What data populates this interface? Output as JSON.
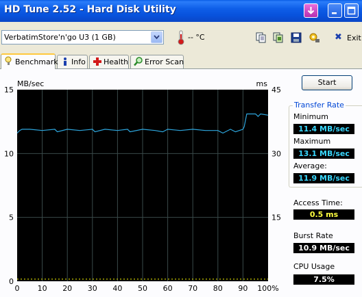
{
  "window": {
    "title": "HD Tune 2.52 - Hard Disk Utility"
  },
  "toolbar": {
    "drive": "VerbatimStore'n'go U3 (1 GB)",
    "temperature": "-- °C",
    "exit_label": "Exit"
  },
  "tabs": [
    {
      "label": "Benchmark"
    },
    {
      "label": "Info"
    },
    {
      "label": "Health"
    },
    {
      "label": "Error Scan"
    }
  ],
  "chart": {
    "y_left_unit": "MB/sec",
    "y_right_unit": "ms",
    "y_left_ticks": [
      "15",
      "10",
      "5",
      "0"
    ],
    "y_right_ticks": [
      "45",
      "30",
      "15"
    ],
    "x_ticks": [
      "0",
      "10",
      "20",
      "30",
      "40",
      "50",
      "60",
      "70",
      "80",
      "90",
      "100%"
    ]
  },
  "chart_data": {
    "type": "line",
    "x_unit": "%",
    "ylim": [
      0,
      15
    ],
    "y2lim": [
      0,
      45
    ],
    "xlim": [
      0,
      100
    ],
    "grid": true,
    "colors": {
      "background": "#000000",
      "grid": "#3a4a4a",
      "transfer": "#2ea8e0",
      "access": "#c8c800"
    },
    "series": [
      {
        "name": "Transfer Rate",
        "axis": "left",
        "x": [
          0,
          1,
          2,
          5,
          10,
          15,
          16,
          20,
          25,
          30,
          31,
          35,
          40,
          44,
          45,
          50,
          55,
          58,
          60,
          65,
          70,
          75,
          80,
          82,
          85,
          87,
          90,
          90.5,
          91.5,
          93,
          95,
          96,
          97,
          100
        ],
        "y": [
          11.6,
          11.8,
          11.9,
          11.9,
          11.8,
          11.9,
          11.7,
          11.9,
          11.8,
          11.9,
          11.7,
          11.9,
          11.8,
          11.9,
          11.7,
          11.9,
          11.8,
          11.7,
          11.9,
          11.8,
          11.9,
          11.8,
          11.8,
          11.6,
          11.9,
          11.7,
          11.9,
          12.1,
          13.1,
          13.1,
          13.1,
          12.9,
          13.1,
          13.0
        ]
      },
      {
        "name": "Access Time",
        "axis": "right",
        "x": [
          0,
          10,
          20,
          30,
          40,
          50,
          60,
          70,
          80,
          90,
          100
        ],
        "y": [
          0.5,
          0.5,
          0.5,
          0.5,
          0.5,
          0.5,
          0.5,
          0.5,
          0.5,
          0.5,
          0.5
        ]
      }
    ]
  },
  "side": {
    "start_label": "Start",
    "transfer_rate_title": "Transfer Rate",
    "minimum_label": "Minimum",
    "minimum_value": "11.4 MB/sec",
    "maximum_label": "Maximum",
    "maximum_value": "13.1 MB/sec",
    "average_label": "Average:",
    "average_value": "11.9 MB/sec",
    "access_label": "Access Time:",
    "access_value": "0.5 ms",
    "burst_label": "Burst Rate",
    "burst_value": "10.9 MB/sec",
    "cpu_label": "CPU Usage",
    "cpu_value": "7.5%"
  }
}
